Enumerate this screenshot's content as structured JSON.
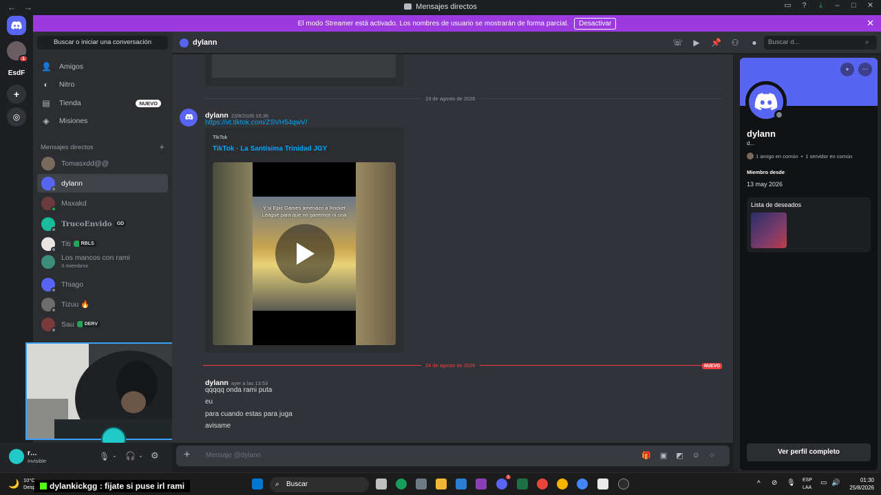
{
  "titlebar": {
    "title": "Mensajes directos",
    "back": "←",
    "forward": "→"
  },
  "banner": {
    "text": "El modo Streamer está activado. Los nombres de usuario se mostrarán de forma parcial.",
    "button": "Desactivar"
  },
  "rail": {
    "server_label": "EsdF",
    "mention_count": "1"
  },
  "sidebar": {
    "search": "Buscar o iniciar una conversación",
    "nav": [
      {
        "label": "Amigos",
        "icon": "friends-icon"
      },
      {
        "label": "Nitro",
        "icon": "nitro-icon"
      },
      {
        "label": "Tienda",
        "icon": "shop-icon",
        "badge": "NUEVO"
      },
      {
        "label": "Misiones",
        "icon": "quests-icon"
      }
    ],
    "dm_header": "Mensajes directos",
    "dms": [
      {
        "name": "Tomasxdd@@",
        "tag": ""
      },
      {
        "name": "dylann",
        "tag": ""
      },
      {
        "name": "Maxakd",
        "tag": ""
      },
      {
        "name": "TrucoEnvido",
        "tag": "GD"
      },
      {
        "name": "Titi",
        "tag": "RBLS"
      },
      {
        "name": "Los mancos con rami",
        "sub": "3 miembros",
        "tag": ""
      },
      {
        "name": "Thiago",
        "tag": ""
      },
      {
        "name": "Tizuu 🔥",
        "tag": ""
      },
      {
        "name": "Sau",
        "tag": "DERV"
      }
    ]
  },
  "userpanel": {
    "name": "r…",
    "status": "Invisible"
  },
  "chat": {
    "header_name": "dylann",
    "search_placeholder": "Buscar d...",
    "date1": "23 de agosto de 2026",
    "msg1": {
      "author": "dylann",
      "time": "23/8/2026 15:36",
      "link": "https://vt.tiktok.com/ZSVH54qwV/"
    },
    "embed": {
      "provider": "TikTok",
      "title": "TikTok · La Santísima Trinidad JGY",
      "video_caption": "Y si Epic Games amenazo a Rocket League para que no ganemos ni una"
    },
    "date2": "24 de agosto de 2026",
    "new_badge": "NUEVO",
    "msg2": {
      "author": "dylann",
      "time": "ayer a las 13:53",
      "lines": [
        "qqqqq onda rami puta",
        "eu",
        "para cuando estas para juga",
        "avisame"
      ]
    },
    "composer_placeholder": "Mensaje @dylann"
  },
  "profile": {
    "name": "dylann",
    "subname": "d...",
    "mutual_friends": "1 amigo en común",
    "mutual_servers": "1 servidor en común",
    "member_since_label": "Miembro desde",
    "member_since": "13 may 2026",
    "wishlist_label": "Lista de deseados",
    "full_profile_button": "Ver perfil completo",
    "banner_color": "#5865f2"
  },
  "stream_overlay": {
    "message": "dylankickgg : fijate si puse irl rami"
  },
  "taskbar": {
    "weather_temp": "10°C",
    "weather_desc": "Despejado",
    "search": "Buscar",
    "lang1": "ESP",
    "lang2": "LAA",
    "time": "01:30",
    "date": "25/8/2026",
    "discord_badge": "1"
  },
  "colors": {
    "accent": "#5865f2",
    "banner": "#9b3bdf",
    "new": "#f23f43"
  }
}
